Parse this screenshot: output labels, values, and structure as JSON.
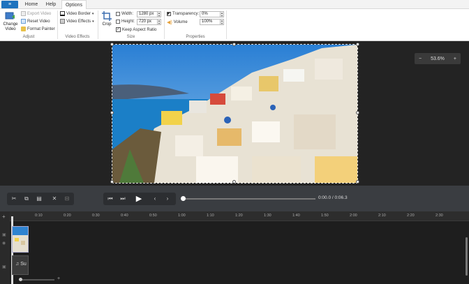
{
  "tabs": {
    "file_icon": "≡",
    "home": "Home",
    "help": "Help",
    "options": "Options"
  },
  "adjust": {
    "change_video": "Change Video",
    "export_video": "Export Video",
    "reset_video": "Reset Video",
    "format_painter": "Format Painter",
    "group_label": "Adjust"
  },
  "effects": {
    "video_border": "Video Border",
    "video_effects": "Video Effects",
    "group_label": "Video Effects"
  },
  "size": {
    "crop": "Crop",
    "width_label": "Width:",
    "width_value": "1280 px",
    "height_label": "Height:",
    "height_value": "720 px",
    "keep_aspect": "Keep Aspect Ratio",
    "group_label": "Size"
  },
  "properties": {
    "transparency_label": "Transparency:",
    "transparency_value": "0%",
    "volume_label": "Volume",
    "volume_value": "100%",
    "group_label": "Properties"
  },
  "zoom": {
    "minus": "−",
    "value": "53.6%",
    "plus": "+"
  },
  "playback": {
    "timecode": "0:00.0 / 0:06.3",
    "position": 0.0
  },
  "ruler_ticks": [
    "0:10",
    "0:20",
    "0:30",
    "0:40",
    "0:50",
    "1:00",
    "1:10",
    "1:20",
    "1:30",
    "1:40",
    "1:50",
    "2:00",
    "2:10",
    "2:20",
    "2:30"
  ],
  "track": {
    "audio_label": "Su"
  }
}
